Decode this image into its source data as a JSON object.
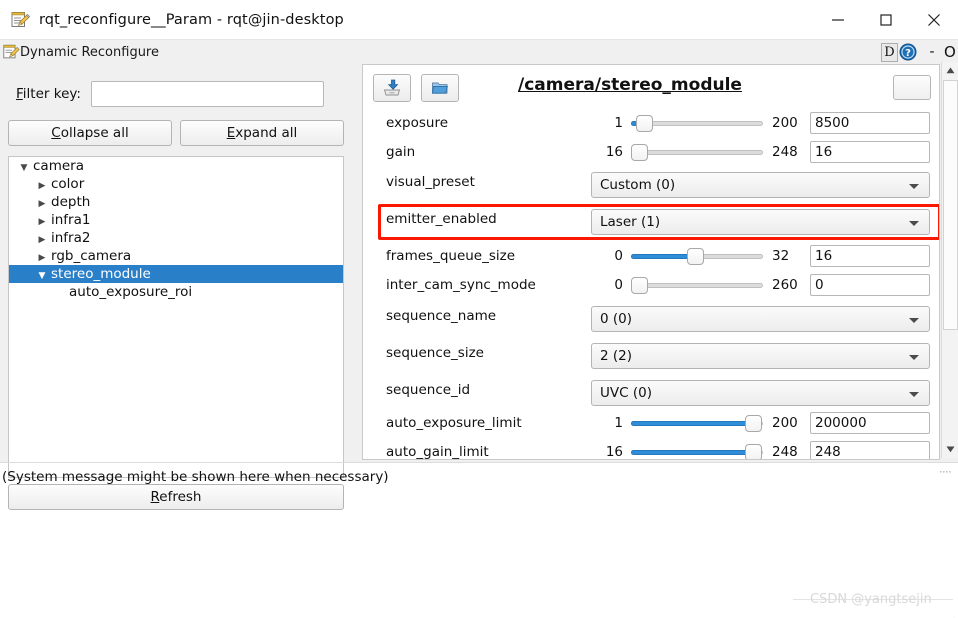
{
  "window": {
    "title": "rqt_reconfigure__Param - rqt@jin-desktop",
    "title_icon": "notepad-pencil-icon",
    "controls": {
      "minimize": "—",
      "maximize": "□",
      "close": "✕"
    }
  },
  "plugin_bar": {
    "title": "Dynamic Reconfigure",
    "icon": "notepad-pencil-icon",
    "dock_button": "D",
    "help_icon": "help-circle-icon",
    "minimize_label": "-",
    "float_label": "O"
  },
  "sidebar": {
    "filter": {
      "label": "Filter key:",
      "mnemonic": "F",
      "value": "",
      "placeholder": ""
    },
    "collapse_all": {
      "label": "Collapse all",
      "mnemonic": "C"
    },
    "expand_all": {
      "label": "Expand all",
      "mnemonic": "E"
    },
    "refresh": {
      "label": "Refresh",
      "mnemonic": "R"
    },
    "tree": [
      {
        "label": "camera",
        "depth": 0,
        "twisty": "down",
        "selected": false
      },
      {
        "label": "color",
        "depth": 1,
        "twisty": "right",
        "selected": false
      },
      {
        "label": "depth",
        "depth": 1,
        "twisty": "right",
        "selected": false
      },
      {
        "label": "infra1",
        "depth": 1,
        "twisty": "right",
        "selected": false
      },
      {
        "label": "infra2",
        "depth": 1,
        "twisty": "right",
        "selected": false
      },
      {
        "label": "rgb_camera",
        "depth": 1,
        "twisty": "right",
        "selected": false
      },
      {
        "label": "stereo_module",
        "depth": 1,
        "twisty": "down",
        "selected": true
      },
      {
        "label": "auto_exposure_roi",
        "depth": 2,
        "twisty": "none",
        "selected": false
      }
    ]
  },
  "panel": {
    "title": "/camera/stereo_module",
    "toolbar": [
      {
        "name": "save-config-button",
        "icon": "save-to-disk-icon"
      },
      {
        "name": "load-config-button",
        "icon": "open-folder-icon"
      }
    ],
    "corner_button": "",
    "highlight_color": "#fb1800",
    "accent_color": "#2d8ddb",
    "selection_color": "#2a7fc9",
    "params": [
      {
        "name": "exposure",
        "type": "slider",
        "min": "1",
        "max": "200",
        "max_clipped": true,
        "value": "8500",
        "fill_ratio": 0.04
      },
      {
        "name": "gain",
        "type": "slider",
        "min": "16",
        "max": "248",
        "max_clipped": false,
        "value": "16",
        "fill_ratio": 0.0
      },
      {
        "name": "visual_preset",
        "type": "combo",
        "value": "Custom (0)"
      },
      {
        "name": "emitter_enabled",
        "type": "combo",
        "value": "Laser (1)",
        "highlighted": true
      },
      {
        "name": "frames_queue_size",
        "type": "slider",
        "min": "0",
        "max": "32",
        "max_clipped": false,
        "value": "16",
        "fill_ratio": 0.5
      },
      {
        "name": "inter_cam_sync_mode",
        "type": "slider",
        "min": "0",
        "max": "260",
        "max_clipped": false,
        "value": "0",
        "fill_ratio": 0.0
      },
      {
        "name": "sequence_name",
        "type": "combo",
        "value": "0 (0)"
      },
      {
        "name": "sequence_size",
        "type": "combo",
        "value": "2 (2)"
      },
      {
        "name": "sequence_id",
        "type": "combo",
        "value": "UVC (0)"
      },
      {
        "name": "auto_exposure_limit",
        "type": "slider",
        "min": "1",
        "max": "200",
        "max_clipped": true,
        "value": "200000",
        "fill_ratio": 1.0
      },
      {
        "name": "auto_gain_limit",
        "type": "slider",
        "min": "16",
        "max": "248",
        "max_clipped": false,
        "value": "248",
        "fill_ratio": 1.0
      }
    ]
  },
  "status": {
    "message": "(System message might be shown here when necessary)"
  },
  "watermark": {
    "text": "CSDN @yangtsejin"
  }
}
